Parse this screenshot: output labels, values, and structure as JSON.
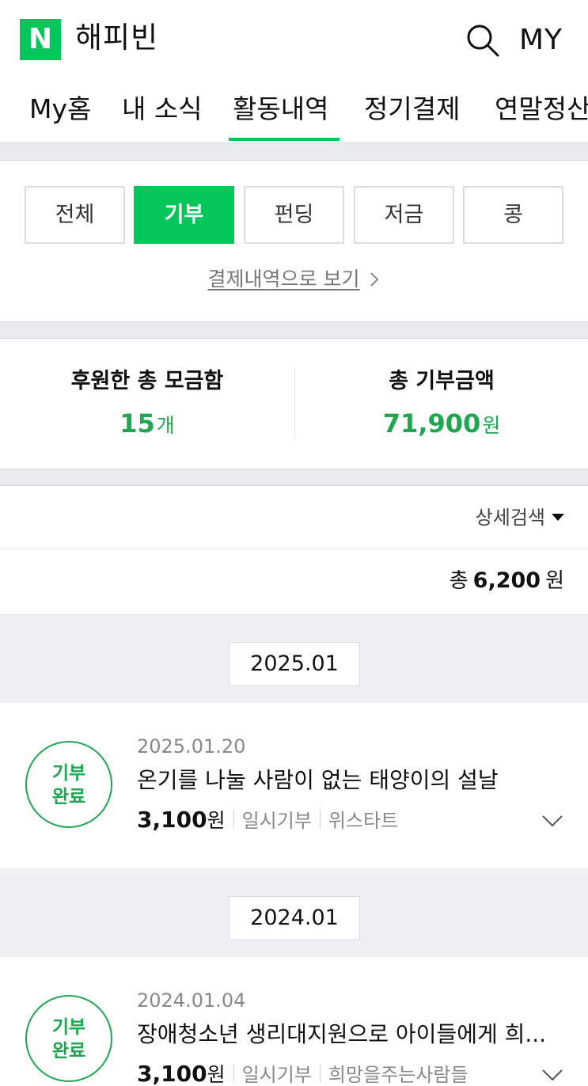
{
  "header": {
    "logo_letter": "N",
    "title": "해피빈",
    "my_label": "MY"
  },
  "tabs": [
    "My홈",
    "내 소식",
    "활동내역",
    "정기결제",
    "연말정산"
  ],
  "active_tab": "활동내역",
  "filters": [
    "전체",
    "기부",
    "펀딩",
    "저금",
    "콩"
  ],
  "active_filter": "기부",
  "payment_link": "결제내역으로 보기",
  "summary": {
    "left_label": "후원한 총 모금함",
    "left_value": "15",
    "left_unit": "개",
    "right_label": "총 기부금액",
    "right_value": "71,900",
    "right_unit": "원"
  },
  "detail_search": "상세검색",
  "total": {
    "prefix": "총",
    "amount": "6,200",
    "unit": "원"
  },
  "groups": [
    {
      "month": "2025.01",
      "items": [
        {
          "status_line1": "기부",
          "status_line2": "완료",
          "date": "2025.01.20",
          "title": "온기를 나눌 사람이 없는 태양이의 설날",
          "amount": "3,100",
          "unit": "원",
          "type": "일시기부",
          "org": "위스타트"
        }
      ]
    },
    {
      "month": "2024.01",
      "items": [
        {
          "status_line1": "기부",
          "status_line2": "완료",
          "date": "2024.01.04",
          "title": "장애청소년 생리대지원으로 아이들에게 희...",
          "amount": "3,100",
          "unit": "원",
          "type": "일시기부",
          "org": "희망을주는사람들"
        }
      ]
    }
  ],
  "colors": {
    "brand_green": "#03c75a",
    "value_green": "#1ea750",
    "band_gray": "#e9ebee"
  }
}
